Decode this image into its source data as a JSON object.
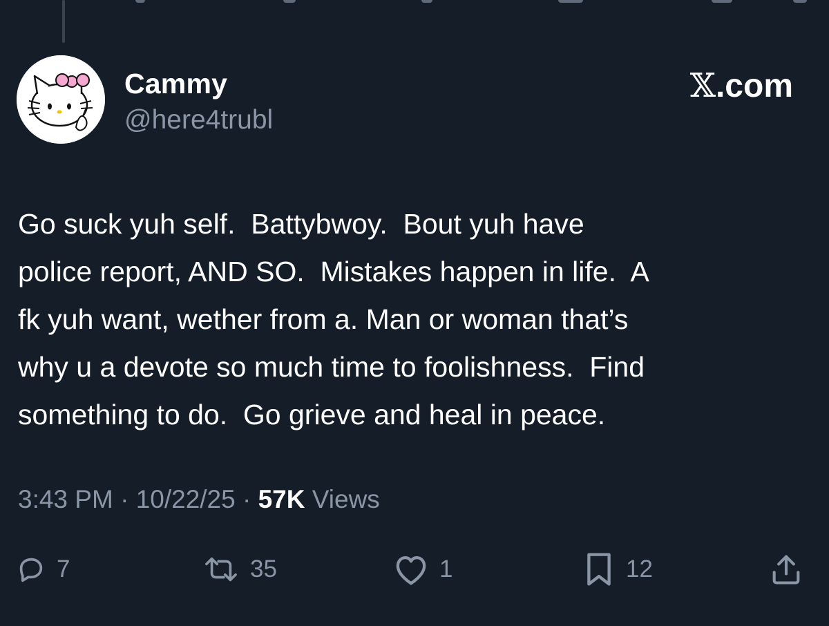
{
  "author": {
    "display_name": "Cammy",
    "handle": "@here4trubl"
  },
  "watermark": {
    "logo_icon": "x-logo-icon",
    "text": ".com"
  },
  "tweet": {
    "text": "Go suck yuh self.  Battybwoy.  Bout yuh have\npolice report, AND SO.  Mistakes happen in life.  A\nfk yuh want, wether from a. Man or woman that’s\nwhy u a devote so much time to foolishness.  Find\nsomething to do.  Go grieve and heal in peace.",
    "time": "3:43 PM",
    "separator": "·",
    "date": "10/22/25",
    "views_count": "57K",
    "views_label": "Views"
  },
  "actions": {
    "replies": {
      "icon": "reply-icon",
      "count": "7"
    },
    "reposts": {
      "icon": "repost-icon",
      "count": "35"
    },
    "likes": {
      "icon": "heart-icon",
      "count": "1"
    },
    "bookmarks": {
      "icon": "bookmark-icon",
      "count": "12"
    },
    "share": {
      "icon": "share-icon"
    }
  },
  "colors": {
    "background": "#151d28",
    "primary_text": "#ffffff",
    "secondary_text": "#8a96a6"
  }
}
